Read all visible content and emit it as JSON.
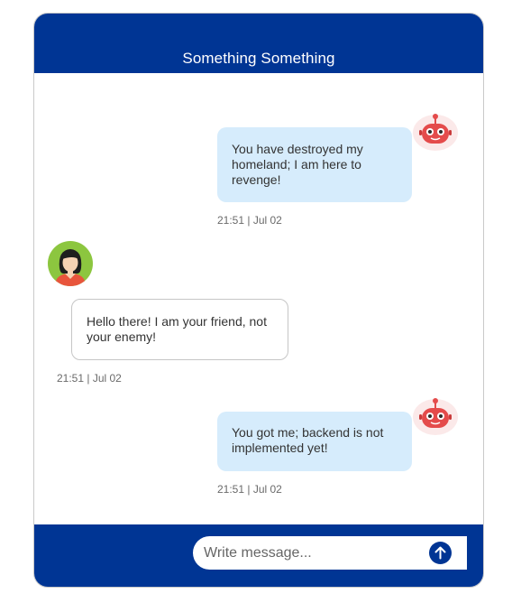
{
  "header": {
    "title": "Something Something"
  },
  "messages": [
    {
      "sender": "bot",
      "avatar_icon": "robot-icon",
      "text": "You have destroyed my homeland; I am here to revenge!",
      "timestamp": "21:51 | Jul 02"
    },
    {
      "sender": "user",
      "avatar_icon": "woman-avatar-icon",
      "text": "Hello there! I am your friend, not your enemy!",
      "timestamp": "21:51 | Jul 02"
    },
    {
      "sender": "bot",
      "avatar_icon": "robot-icon",
      "text": "You got me; backend is not implemented yet!",
      "timestamp": "21:51 | Jul 02"
    }
  ],
  "composer": {
    "placeholder": "Write message...",
    "send_icon": "arrow-up-icon"
  },
  "colors": {
    "brand": "#003594",
    "bot_bubble": "#d6ecfc",
    "user_bubble_border": "#c6c6c6",
    "robot_red": "#e44b4b"
  }
}
